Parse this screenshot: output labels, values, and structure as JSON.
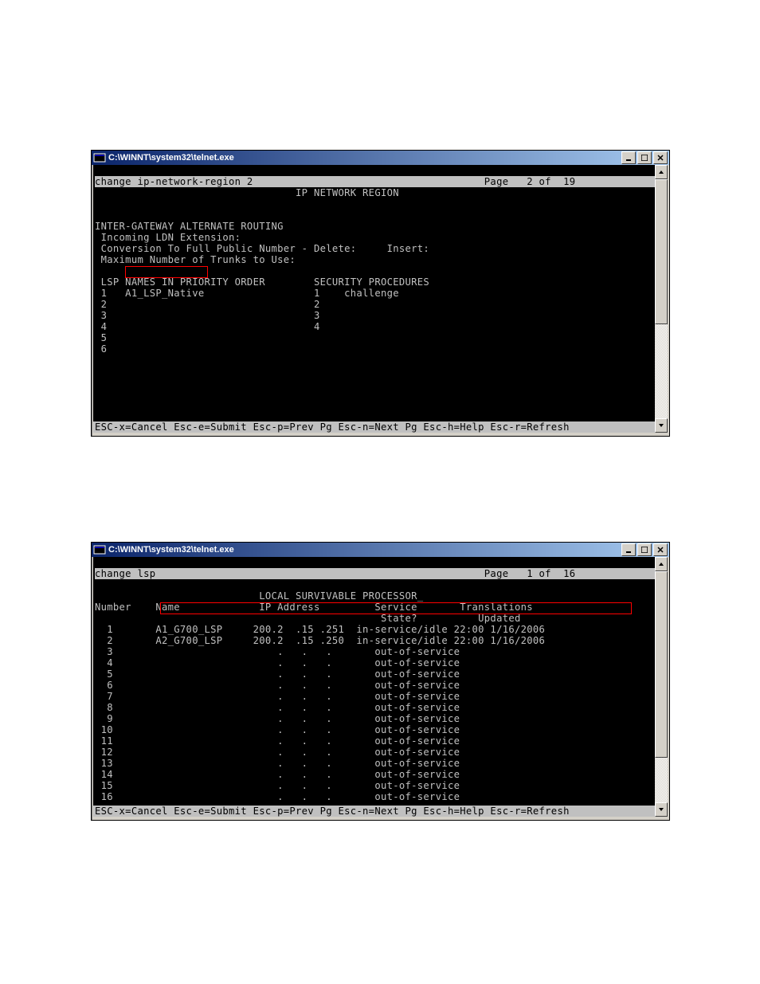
{
  "window1": {
    "title": "C:\\WINNT\\system32\\telnet.exe",
    "header": "change ip-network-region 2                                      Page   2 of  19",
    "page_title": "                                 IP NETWORK REGION",
    "body_lines": [
      "",
      "",
      "INTER-GATEWAY ALTERNATE ROUTING",
      " Incoming LDN Extension:",
      " Conversion To Full Public Number - Delete:     Insert:",
      " Maximum Number of Trunks to Use:",
      "",
      " LSP NAMES IN PRIORITY ORDER        SECURITY PROCEDURES",
      " 1   A1_LSP_Native                  1    challenge",
      " 2                                  2",
      " 3                                  3",
      " 4                                  4",
      " 5",
      " 6"
    ],
    "footer": "ESC-x=Cancel Esc-e=Submit Esc-p=Prev Pg Esc-n=Next Pg Esc-h=Help Esc-r=Refresh",
    "lsp_names": [
      {
        "n": "1",
        "name": "A1_LSP_Native"
      },
      {
        "n": "2",
        "name": ""
      },
      {
        "n": "3",
        "name": ""
      },
      {
        "n": "4",
        "name": ""
      },
      {
        "n": "5",
        "name": ""
      },
      {
        "n": "6",
        "name": ""
      }
    ],
    "security_procedures": [
      {
        "n": "1",
        "value": "challenge"
      },
      {
        "n": "2",
        "value": ""
      },
      {
        "n": "3",
        "value": ""
      },
      {
        "n": "4",
        "value": ""
      }
    ]
  },
  "window2": {
    "title": "C:\\WINNT\\system32\\telnet.exe",
    "header": "change lsp                                                      Page   1 of  16",
    "page_title": "                           LOCAL SURVIVABLE PROCESSOR_",
    "col_header1": "Number    Name             IP Address         Service       Translations",
    "col_header2": "                                               State?          Updated",
    "rows": [
      {
        "num": "1",
        "name": "A1_G700_LSP",
        "ip": "200.2  .15 .251",
        "state": "in-service/idle",
        "updated": "22:00 1/16/2006"
      },
      {
        "num": "2",
        "name": "A2_G700_LSP",
        "ip": "200.2  .15 .250",
        "state": "in-service/idle",
        "updated": "22:00 1/16/2006"
      },
      {
        "num": "3",
        "name": "",
        "ip": "   .   .   .   ",
        "state": "out-of-service",
        "updated": ""
      },
      {
        "num": "4",
        "name": "",
        "ip": "   .   .   .   ",
        "state": "out-of-service",
        "updated": ""
      },
      {
        "num": "5",
        "name": "",
        "ip": "   .   .   .   ",
        "state": "out-of-service",
        "updated": ""
      },
      {
        "num": "6",
        "name": "",
        "ip": "   .   .   .   ",
        "state": "out-of-service",
        "updated": ""
      },
      {
        "num": "7",
        "name": "",
        "ip": "   .   .   .   ",
        "state": "out-of-service",
        "updated": ""
      },
      {
        "num": "8",
        "name": "",
        "ip": "   .   .   .   ",
        "state": "out-of-service",
        "updated": ""
      },
      {
        "num": "9",
        "name": "",
        "ip": "   .   .   .   ",
        "state": "out-of-service",
        "updated": ""
      },
      {
        "num": "10",
        "name": "",
        "ip": "   .   .   .   ",
        "state": "out-of-service",
        "updated": ""
      },
      {
        "num": "11",
        "name": "",
        "ip": "   .   .   .   ",
        "state": "out-of-service",
        "updated": ""
      },
      {
        "num": "12",
        "name": "",
        "ip": "   .   .   .   ",
        "state": "out-of-service",
        "updated": ""
      },
      {
        "num": "13",
        "name": "",
        "ip": "   .   .   .   ",
        "state": "out-of-service",
        "updated": ""
      },
      {
        "num": "14",
        "name": "",
        "ip": "   .   .   .   ",
        "state": "out-of-service",
        "updated": ""
      },
      {
        "num": "15",
        "name": "",
        "ip": "   .   .   .   ",
        "state": "out-of-service",
        "updated": ""
      },
      {
        "num": "16",
        "name": "",
        "ip": "   .   .   .   ",
        "state": "out-of-service",
        "updated": ""
      }
    ],
    "footer": "ESC-x=Cancel Esc-e=Submit Esc-p=Prev Pg Esc-n=Next Pg Esc-h=Help Esc-r=Refresh"
  }
}
